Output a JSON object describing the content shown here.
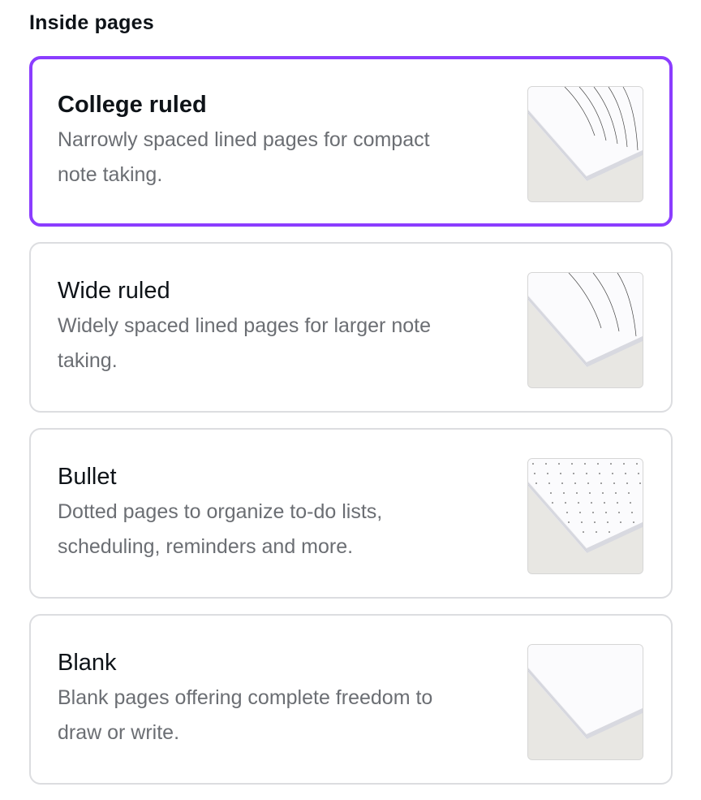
{
  "section": {
    "heading": "Inside pages"
  },
  "options": [
    {
      "title": "College ruled",
      "description_line1": "Narrowly spaced lined pages for compact",
      "description_line2": "note taking.",
      "thumbnail_icon": "college-ruled-paper-icon",
      "selected": true
    },
    {
      "title": "Wide ruled",
      "description_line1": "Widely spaced lined pages for larger note",
      "description_line2": "taking.",
      "thumbnail_icon": "wide-ruled-paper-icon",
      "selected": false
    },
    {
      "title": "Bullet",
      "description_line1": "Dotted pages to organize to-do lists,",
      "description_line2": "scheduling, reminders and more.",
      "thumbnail_icon": "dotted-paper-icon",
      "selected": false
    },
    {
      "title": "Blank",
      "description_line1": "Blank pages offering complete freedom to",
      "description_line2": "draw or write.",
      "thumbnail_icon": "blank-paper-icon",
      "selected": false
    }
  ],
  "colors": {
    "accent": "#8b3dff",
    "card_border": "#dcdde0",
    "description_text": "#6b6e73",
    "title_text": "#0e1318"
  }
}
